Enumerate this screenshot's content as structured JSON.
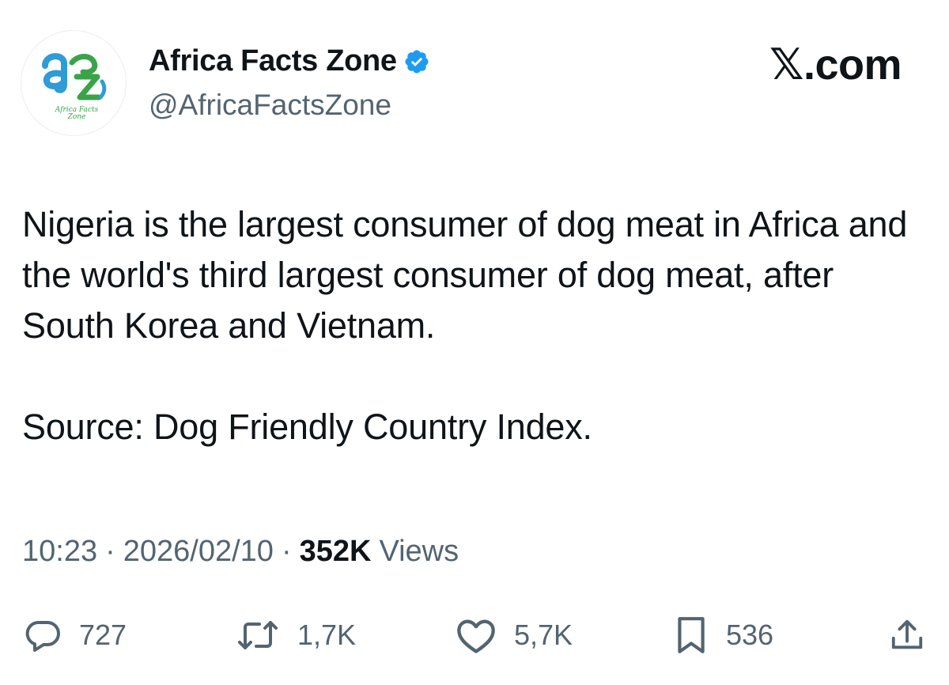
{
  "author": {
    "display_name": "Africa Facts Zone",
    "handle": "@AfricaFactsZone",
    "avatar_text": "Africa Facts Zone",
    "verified": true,
    "verified_icon": "verified-badge-icon"
  },
  "brand": {
    "logo_mark": "𝕏",
    "logo_suffix": ".com"
  },
  "tweet": {
    "paragraphs": [
      "Nigeria is the largest consumer of dog meat in Africa and the world's third largest consumer of dog meat, after South Korea and Vietnam.",
      "Source: Dog Friendly Country Index."
    ]
  },
  "meta": {
    "time": "10:23",
    "date": "2026/02/10",
    "separator": "·",
    "views_count": "352K",
    "views_label": "Views"
  },
  "actions": {
    "replies": "727",
    "reposts": "1,7K",
    "likes": "5,7K",
    "bookmarks": "536"
  },
  "colors": {
    "text_primary": "#0f1419",
    "text_secondary": "#536471",
    "verified_blue": "#1d9bf0",
    "logo_blue": "#2f9bd7",
    "logo_green": "#3aa34a"
  }
}
